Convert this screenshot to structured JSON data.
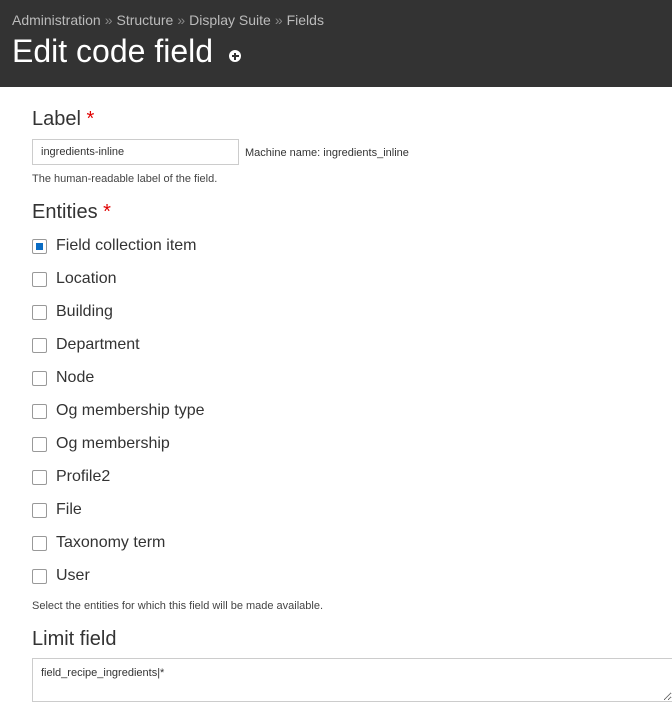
{
  "breadcrumb": [
    {
      "label": "Administration"
    },
    {
      "label": "Structure"
    },
    {
      "label": "Display Suite"
    },
    {
      "label": "Fields"
    }
  ],
  "breadcrumb_separator": "»",
  "page": {
    "title": "Edit code field"
  },
  "label_field": {
    "label": "Label",
    "required_marker": "*",
    "value": "ingredients-inline",
    "machine_name": "Machine name: ingredients_inline",
    "description": "The human-readable label of the field."
  },
  "entities": {
    "label": "Entities",
    "required_marker": "*",
    "items": [
      {
        "label": "Field collection item",
        "checked": true
      },
      {
        "label": "Location",
        "checked": false
      },
      {
        "label": "Building",
        "checked": false
      },
      {
        "label": "Department",
        "checked": false
      },
      {
        "label": "Node",
        "checked": false
      },
      {
        "label": "Og membership type",
        "checked": false
      },
      {
        "label": "Og membership",
        "checked": false
      },
      {
        "label": "Profile2",
        "checked": false
      },
      {
        "label": "File",
        "checked": false
      },
      {
        "label": "Taxonomy term",
        "checked": false
      },
      {
        "label": "User",
        "checked": false
      }
    ],
    "description": "Select the entities for which this field will be made available."
  },
  "limit_field": {
    "label": "Limit field",
    "value": "field_recipe_ingredients|*"
  },
  "colors": {
    "header_bg": "#333333",
    "required": "#e00000",
    "checkbox_checked": "#0a6cc4"
  }
}
